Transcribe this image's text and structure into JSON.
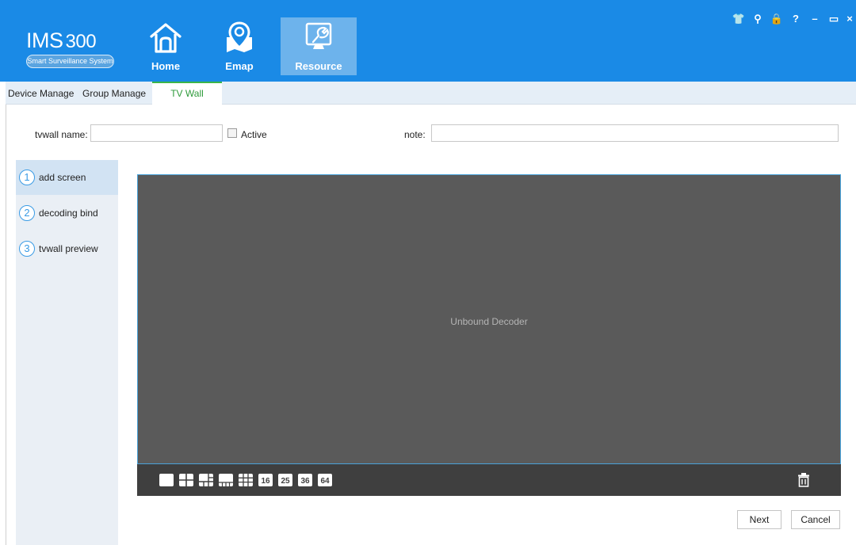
{
  "app": {
    "logo_title": "IMS",
    "logo_number": "300",
    "logo_subtitle": "Smart Surveillance System"
  },
  "nav": [
    {
      "label": "Home",
      "icon": "home-icon",
      "active": false
    },
    {
      "label": "Emap",
      "icon": "map-pin-icon",
      "active": false
    },
    {
      "label": "Resource",
      "icon": "wrench-icon",
      "active": true
    }
  ],
  "window_controls": [
    {
      "glyph": "👕",
      "icon": "skin-icon"
    },
    {
      "glyph": "⚲",
      "icon": "user-icon"
    },
    {
      "glyph": "🔒",
      "icon": "lock-icon"
    },
    {
      "glyph": "?",
      "icon": "help-icon"
    },
    {
      "glyph": "–",
      "icon": "minimize-icon"
    },
    {
      "glyph": "▭",
      "icon": "maximize-icon"
    },
    {
      "glyph": "×",
      "icon": "close-icon"
    }
  ],
  "tabs": [
    {
      "label": "Device Manage",
      "active": false
    },
    {
      "label": "Group Manage",
      "active": false
    },
    {
      "label": "TV Wall",
      "active": true
    }
  ],
  "form": {
    "tvwall_name_label": "tvwall name:",
    "tvwall_name_value": "",
    "active_label": "Active",
    "active_checked": false,
    "note_label": "note:",
    "note_value": ""
  },
  "steps": [
    {
      "num": "1",
      "label": "add screen",
      "active": true
    },
    {
      "num": "2",
      "label": "decoding bind",
      "active": false
    },
    {
      "num": "3",
      "label": "tvwall preview",
      "active": false
    }
  ],
  "preview": {
    "status_text": "Unbound Decoder"
  },
  "layouts": [
    {
      "name": "layout-1-button",
      "label": ""
    },
    {
      "name": "layout-4-button",
      "label": ""
    },
    {
      "name": "layout-6-button",
      "label": ""
    },
    {
      "name": "layout-8-button",
      "label": ""
    },
    {
      "name": "layout-9-button",
      "label": ""
    },
    {
      "name": "layout-16-button",
      "label": "16"
    },
    {
      "name": "layout-25-button",
      "label": "25"
    },
    {
      "name": "layout-36-button",
      "label": "36"
    },
    {
      "name": "layout-64-button",
      "label": "64"
    }
  ],
  "buttons": {
    "next": "Next",
    "cancel": "Cancel"
  },
  "colors": {
    "header": "#1a8ae6",
    "accent_tab": "#39b54a",
    "preview_bg": "#5a5a5a",
    "toolbar_bg": "#3f3f3f"
  }
}
